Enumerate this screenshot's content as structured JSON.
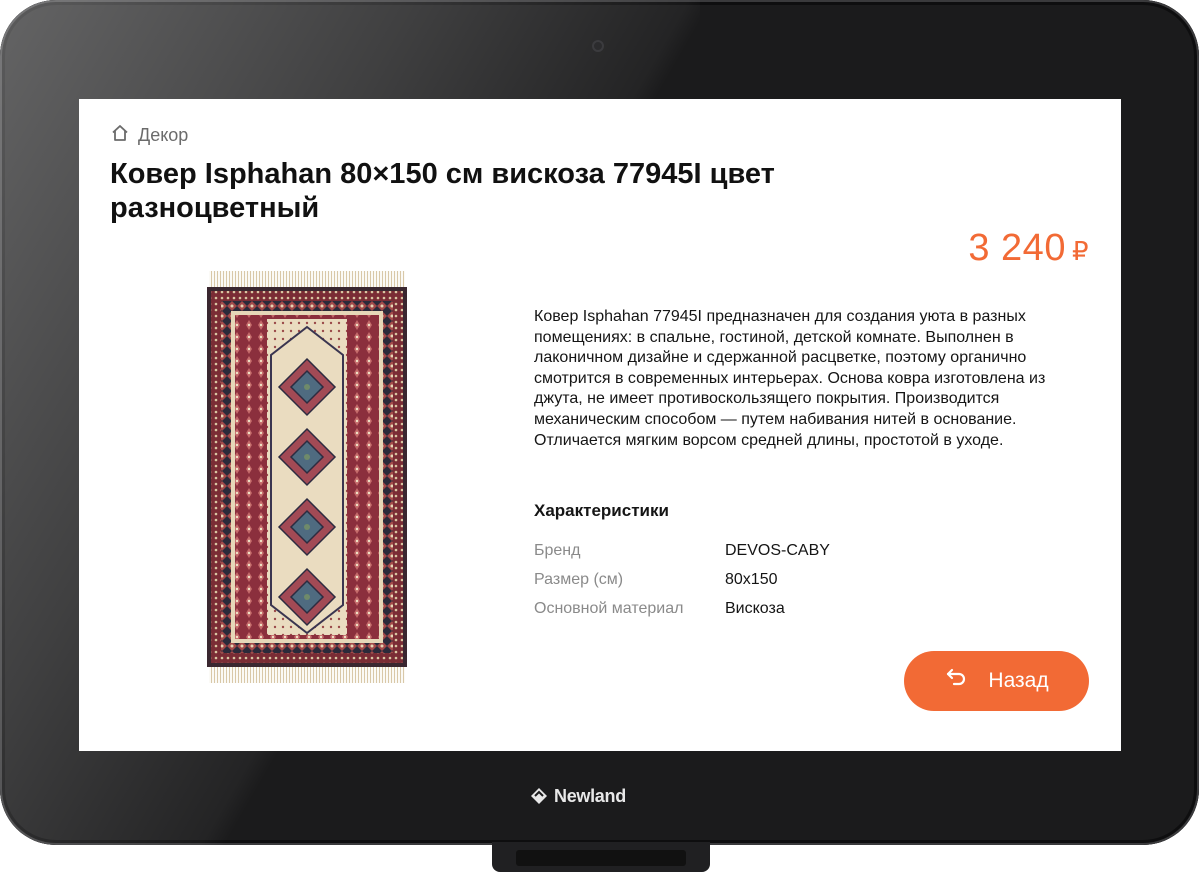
{
  "breadcrumb": {
    "icon": "home-icon",
    "label": "Декор"
  },
  "product": {
    "title": "Ковер Isphahan 80×150 см вискоза 77945I цвет разноцветный",
    "price_value": "3 240",
    "price_currency": "₽",
    "image_icon": "rug-product-image",
    "description": "Ковер Isphahan 77945I предназначен для создания уюта в разных помещениях: в спальне, гостиной, детской комнате. Выполнен в лаконичном дизайне и сдержанной расцветке, поэтому органично смотрится в современных интерьерах. Основа ковра изготовлена из джута, не имеет противоскользящего покрытия. Производится механическим способом — путем набивания нитей в основание. Отличается мягким ворсом средней длины, простотой в уходе."
  },
  "specs": {
    "title": "Характеристики",
    "rows": [
      {
        "key": "Бренд",
        "value": "DEVOS-CABY"
      },
      {
        "key": "Размер (см)",
        "value": "80x150"
      },
      {
        "key": "Основной материал",
        "value": "Вискоза"
      }
    ]
  },
  "back_button": {
    "label": "Назад",
    "icon": "undo-arrow-icon"
  },
  "device": {
    "brand": "Newland"
  },
  "colors": {
    "accent": "#f26a35",
    "frame": "#1b1b1c",
    "text": "#151515",
    "muted": "#8a8a8a"
  }
}
